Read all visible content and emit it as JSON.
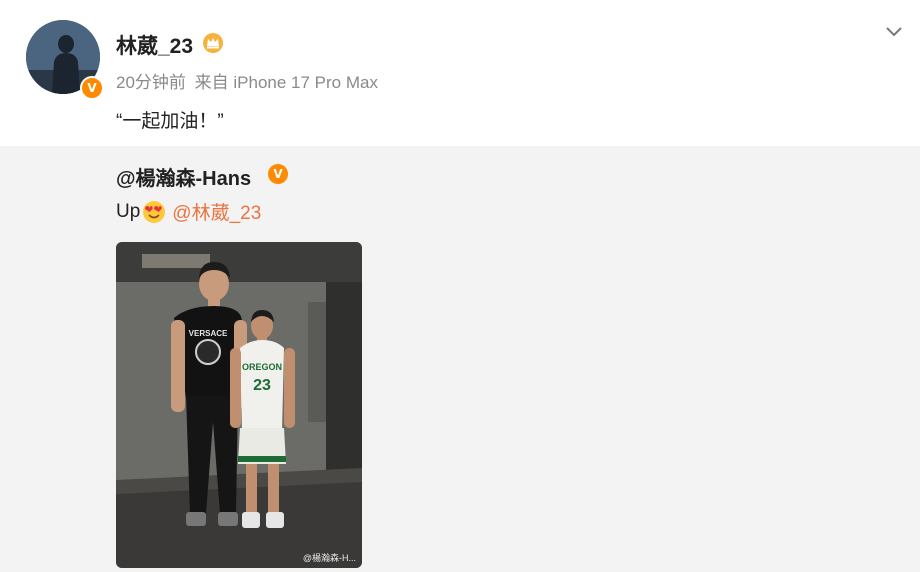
{
  "post": {
    "username": "林葳_23",
    "time": "20分钟前",
    "source_prefix": "来自",
    "source_device": "iPhone 17 Pro Max",
    "text": "“一起加油！”"
  },
  "repost": {
    "author": "@楊瀚森-Hans",
    "text_prefix": "Up",
    "mention": "@林葳_23",
    "photo_jersey_text": "OREGON",
    "photo_jersey_number": "23",
    "photo_shirt_text": "VERSACE",
    "watermark": "@楊瀚森-H..."
  },
  "icons": {
    "verified": "verified-v-icon",
    "member_badge": "crown-badge-icon",
    "more": "chevron-down-icon",
    "emoji": "heart-eyes-emoji"
  },
  "colors": {
    "mention": "#eb7340",
    "verified": "#ff8a00",
    "meta_text": "#8a8a8a",
    "repost_bg": "#f3f3f3"
  }
}
